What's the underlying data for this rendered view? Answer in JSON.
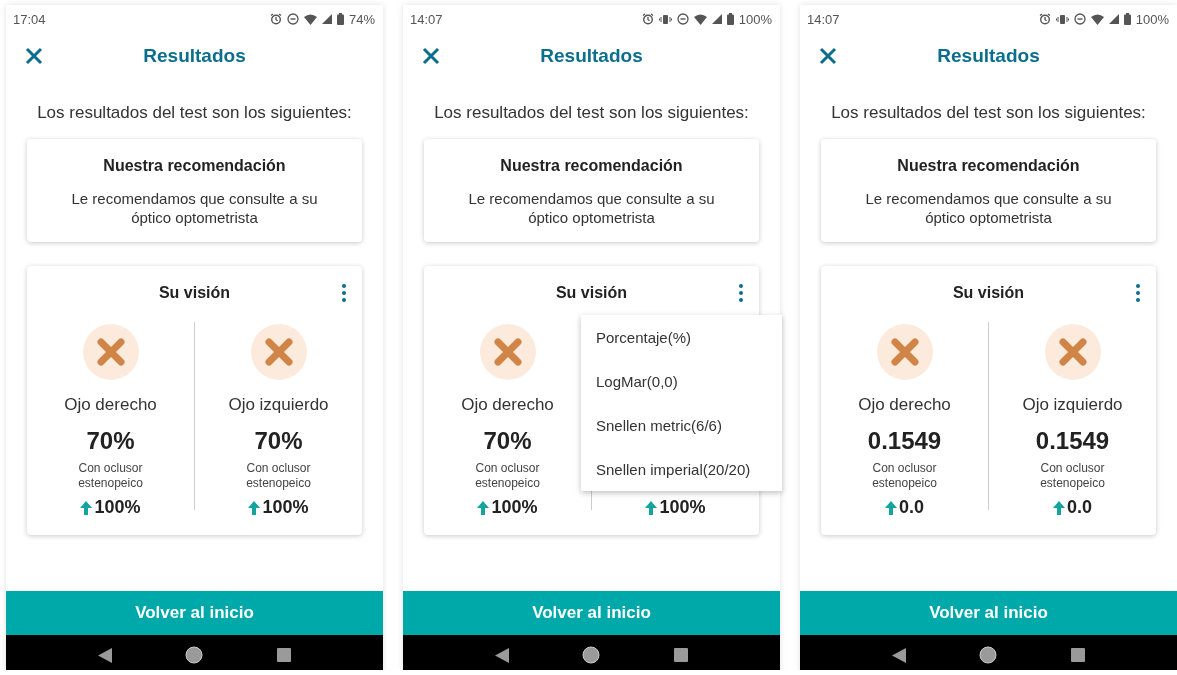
{
  "screens": [
    {
      "status": {
        "time": "17:04",
        "vibrate": false,
        "battery": "74%"
      },
      "title": "Resultados",
      "intro": "Los resultados del test son los siguientes:",
      "recommendation": {
        "title": "Nuestra recomendación",
        "text": "Le recomendamos que consulte a su óptico optometrista"
      },
      "vision": {
        "title": "Su visión",
        "eyes": [
          {
            "label": "Ojo derecho",
            "value": "70%",
            "note": "Con oclusor estenopeico",
            "improvement": "100%"
          },
          {
            "label": "Ojo izquierdo",
            "value": "70%",
            "note": "Con oclusor estenopeico",
            "improvement": "100%"
          }
        ]
      },
      "button": "Volver al inicio"
    },
    {
      "status": {
        "time": "14:07",
        "vibrate": true,
        "battery": "100%"
      },
      "title": "Resultados",
      "intro": "Los resultados del test son los siguientes:",
      "recommendation": {
        "title": "Nuestra recomendación",
        "text": "Le recomendamos que consulte a su óptico optometrista"
      },
      "vision": {
        "title": "Su visión",
        "eyes": [
          {
            "label": "Ojo derecho",
            "value": "70%",
            "note": "Con oclusor estenopeico",
            "improvement": "100%"
          },
          {
            "improvement": "100%"
          }
        ],
        "menu": [
          "Porcentaje(%)",
          "LogMar(0,0)",
          "Snellen metric(6/6)",
          "Snellen imperial(20/20)"
        ]
      },
      "button": "Volver al inicio"
    },
    {
      "status": {
        "time": "14:07",
        "vibrate": true,
        "battery": "100%"
      },
      "title": "Resultados",
      "intro": "Los resultados del test son los siguientes:",
      "recommendation": {
        "title": "Nuestra recomendación",
        "text": "Le recomendamos que consulte a su óptico optometrista"
      },
      "vision": {
        "title": "Su visión",
        "eyes": [
          {
            "label": "Ojo derecho",
            "value": "0.1549",
            "note": "Con oclusor estenopeico",
            "improvement": "0.0"
          },
          {
            "label": "Ojo izquierdo",
            "value": "0.1549",
            "note": "Con oclusor estenopeico",
            "improvement": "0.0"
          }
        ]
      },
      "button": "Volver al inicio"
    }
  ]
}
